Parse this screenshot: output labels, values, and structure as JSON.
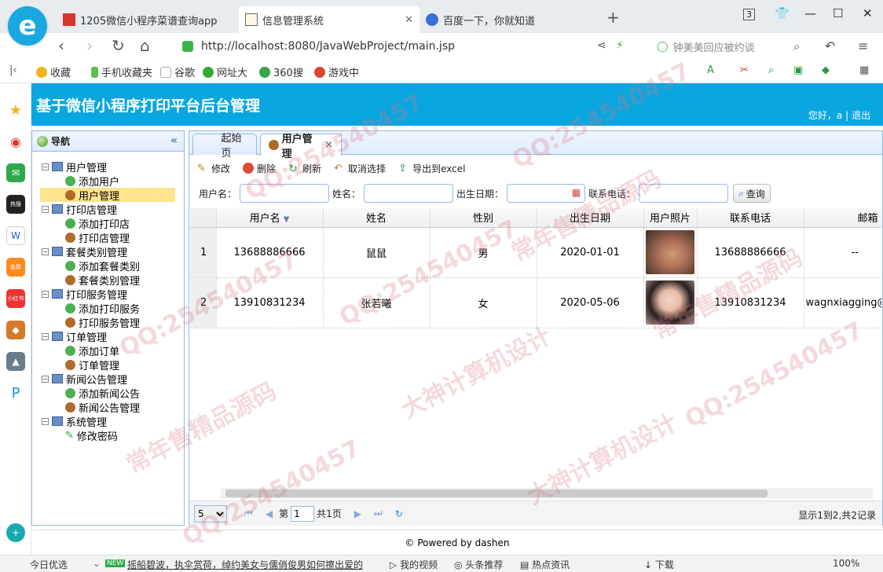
{
  "browser": {
    "tabs": [
      {
        "title": "1205微信小程序菜谱查询app",
        "active": false
      },
      {
        "title": "信息管理系统",
        "active": true
      },
      {
        "title": "百度一下，你就知道",
        "active": false
      }
    ],
    "new_tab": "+",
    "window_counter": "3",
    "url": "http://localhost:8080/JavaWebProject/main.jsp",
    "search_text": "钟美美回应被约谈",
    "bookmarks": [
      "收藏",
      "手机收藏夹",
      "谷歌",
      "网址大",
      "360搜",
      "游戏中"
    ]
  },
  "app": {
    "title": "基于微信小程序打印平台后台管理",
    "greeting": "您好，a",
    "separator": "|",
    "logout": "退出"
  },
  "nav": {
    "title": "导航",
    "groups": [
      {
        "label": "用户管理",
        "children": [
          "添加用户",
          "用户管理"
        ]
      },
      {
        "label": "打印店管理",
        "children": [
          "添加打印店",
          "打印店管理"
        ]
      },
      {
        "label": "套餐类别管理",
        "children": [
          "添加套餐类别",
          "套餐类别管理"
        ]
      },
      {
        "label": "打印服务管理",
        "children": [
          "添加打印服务",
          "打印服务管理"
        ]
      },
      {
        "label": "订单管理",
        "children": [
          "添加订单",
          "订单管理"
        ]
      },
      {
        "label": "新闻公告管理",
        "children": [
          "添加新闻公告",
          "新闻公告管理"
        ]
      },
      {
        "label": "系统管理",
        "children": [
          "修改密码"
        ]
      }
    ],
    "selected": "用户管理"
  },
  "tabs": [
    {
      "label": "起始页",
      "active": false
    },
    {
      "label": "用户管理",
      "active": true,
      "close": "×"
    }
  ],
  "toolbar": {
    "edit": "修改",
    "delete": "删除",
    "refresh": "刷新",
    "cancel_select": "取消选择",
    "export": "导出到excel"
  },
  "search": {
    "username_label": "用户名：",
    "name_label": "姓名：",
    "birth_label": "出生日期：",
    "phone_label": "联系电话：",
    "query_button": "查询"
  },
  "grid": {
    "columns": [
      "用户名",
      "姓名",
      "性别",
      "出生日期",
      "用户照片",
      "联系电话",
      "邮箱"
    ],
    "rows": [
      {
        "rownum": "1",
        "username": "13688886666",
        "name": "鼠鼠",
        "gender": "男",
        "birth": "2020-01-01",
        "phone": "13688886666",
        "email": "--"
      },
      {
        "rownum": "2",
        "username": "13910831234",
        "name": "张若曦",
        "gender": "女",
        "birth": "2020-05-06",
        "phone": "13910831234",
        "email": "wagnxiagging@"
      }
    ]
  },
  "pager": {
    "page_size": "5",
    "page_prefix": "第",
    "page_value": "1",
    "page_total": "共1页",
    "info": "显示1到2,共2记录"
  },
  "footer": "© Powered by dashen",
  "statusbar": {
    "left": "今日优选",
    "news_badge": "NEW",
    "news": "摇船碧波，执伞赏荷，绰约美女与儒俏俊男如何擦出爱的",
    "video": "我的视频",
    "hot": "头条推荐",
    "info": "热点资讯",
    "download": "下载",
    "zoom": "100%"
  },
  "watermarks": [
    "QQ:254540457",
    "常年售精品源码",
    "大神计算机设计"
  ],
  "colors": {
    "header": "#0aa6e0",
    "panel_border": "#95b8e7",
    "selected_row": "#ffe48d"
  }
}
